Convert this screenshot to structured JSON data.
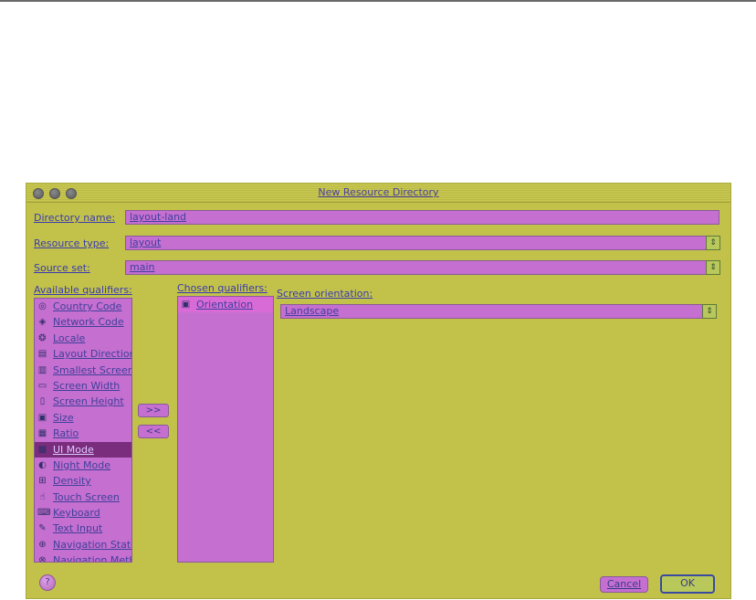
{
  "dialog": {
    "title": "New Resource Directory",
    "directory_name_label": "Directory name:",
    "directory_name_value": "layout-land",
    "resource_type_label": "Resource type:",
    "resource_type_value": "layout",
    "source_set_label": "Source set:",
    "source_set_value": "main",
    "available_label": "Available qualifiers:",
    "chosen_label": "Chosen qualifiers:",
    "orientation_label": "Screen orientation:",
    "orientation_value": "Landscape",
    "add_button": ">>",
    "remove_button": "<<",
    "cancel_button": "Cancel",
    "ok_button": "OK"
  },
  "available_qualifiers": [
    {
      "label": "Country Code",
      "icon": "globe-icon",
      "glyph": "◎"
    },
    {
      "label": "Network Code",
      "icon": "network-icon",
      "glyph": "◈"
    },
    {
      "label": "Locale",
      "icon": "locale-icon",
      "glyph": "❂"
    },
    {
      "label": "Layout Direction",
      "icon": "layout-direction-icon",
      "glyph": "▤"
    },
    {
      "label": "Smallest Screen Width",
      "icon": "smallest-width-icon",
      "glyph": "▥"
    },
    {
      "label": "Screen Width",
      "icon": "screen-width-icon",
      "glyph": "▭"
    },
    {
      "label": "Screen Height",
      "icon": "screen-height-icon",
      "glyph": "▯"
    },
    {
      "label": "Size",
      "icon": "size-icon",
      "glyph": "▣"
    },
    {
      "label": "Ratio",
      "icon": "ratio-icon",
      "glyph": "▦"
    },
    {
      "label": "UI Mode",
      "icon": "ui-mode-icon",
      "glyph": "▩"
    },
    {
      "label": "Night Mode",
      "icon": "night-mode-icon",
      "glyph": "◐"
    },
    {
      "label": "Density",
      "icon": "density-icon",
      "glyph": "⊞"
    },
    {
      "label": "Touch Screen",
      "icon": "touch-screen-icon",
      "glyph": "☝"
    },
    {
      "label": "Keyboard",
      "icon": "keyboard-icon",
      "glyph": "⌨"
    },
    {
      "label": "Text Input",
      "icon": "text-input-icon",
      "glyph": "✎"
    },
    {
      "label": "Navigation State",
      "icon": "navigation-state-icon",
      "glyph": "⊕"
    },
    {
      "label": "Navigation Method",
      "icon": "navigation-method-icon",
      "glyph": "⊗"
    }
  ],
  "chosen_qualifiers": [
    {
      "label": "Orientation",
      "icon": "orientation-icon",
      "glyph": "▣"
    }
  ]
}
